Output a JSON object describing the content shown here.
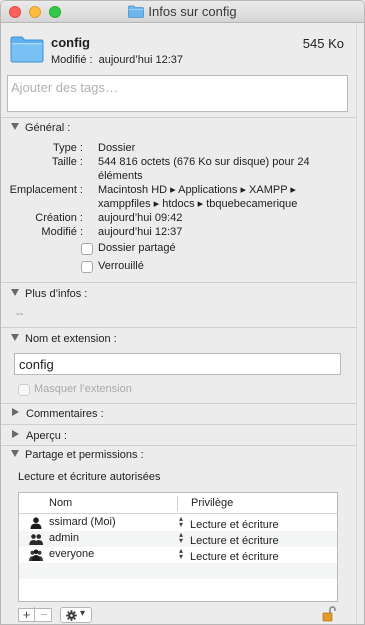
{
  "window": {
    "title": "Infos sur config"
  },
  "header": {
    "name": "config",
    "size": "545 Ko",
    "modified_label": "Modifié :",
    "modified_value": "aujourd’hui 12:37"
  },
  "tags": {
    "placeholder": "Ajouter des tags…"
  },
  "general": {
    "title": "Général :",
    "rows": [
      {
        "key": "Type :",
        "value": "Dossier"
      },
      {
        "key": "Taille :",
        "value": "544 816 octets (676 Ko sur disque) pour 24",
        "value2": "éléments"
      },
      {
        "key": "Emplacement :",
        "value": "Macintosh HD ▸ Applications ▸ XAMPP ▸",
        "value2": "xamppfiles ▸ htdocs ▸ tbquebecamerique"
      },
      {
        "key": "Création :",
        "value": "aujourd’hui 09:42"
      },
      {
        "key": "Modifié :",
        "value": "aujourd’hui 12:37"
      }
    ],
    "shared_folder": "Dossier partagé",
    "locked": "Verrouillé"
  },
  "more_info": {
    "title": "Plus d’infos :",
    "value": "--"
  },
  "name_ext": {
    "title": "Nom et extension :",
    "field_value": "config",
    "hide_extension": "Masquer l’extension"
  },
  "comments": {
    "title": "Commentaires :"
  },
  "preview": {
    "title": "Aperçu :"
  },
  "sharing": {
    "title": "Partage et permissions :",
    "status": "Lecture et écriture autorisées",
    "columns": [
      "Nom",
      "Privilège"
    ],
    "rows": [
      {
        "name": "ssimard (Moi)",
        "privilege": "Lecture et écriture",
        "icon": "single-user-icon"
      },
      {
        "name": "admin",
        "privilege": "Lecture et écriture",
        "icon": "group-icon"
      },
      {
        "name": "everyone",
        "privilege": "Lecture et écriture",
        "icon": "everyone-icon"
      }
    ],
    "add_label": "+",
    "remove_label": "−",
    "gear_caret": "▾"
  }
}
